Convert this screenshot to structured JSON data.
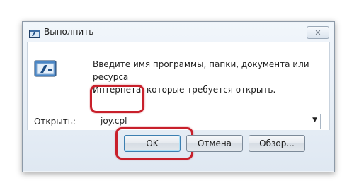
{
  "window": {
    "title": "Выполнить"
  },
  "dialog": {
    "description_line1": "Введите имя программы, папки, документа или ресурса",
    "description_line2": "Интернета, которые требуется открыть.",
    "open_label": "Открыть:",
    "open_value": "joy.cpl"
  },
  "buttons": {
    "ok": "OK",
    "cancel": "Отмена",
    "browse": "Обзор..."
  },
  "close_glyph": "✕",
  "dropdown_glyph": "▼",
  "icons": [
    "run-icon",
    "close-icon",
    "chevron-down-icon"
  ],
  "colors": {
    "highlight": "#c8202b",
    "window_border": "#8d9aa8"
  }
}
